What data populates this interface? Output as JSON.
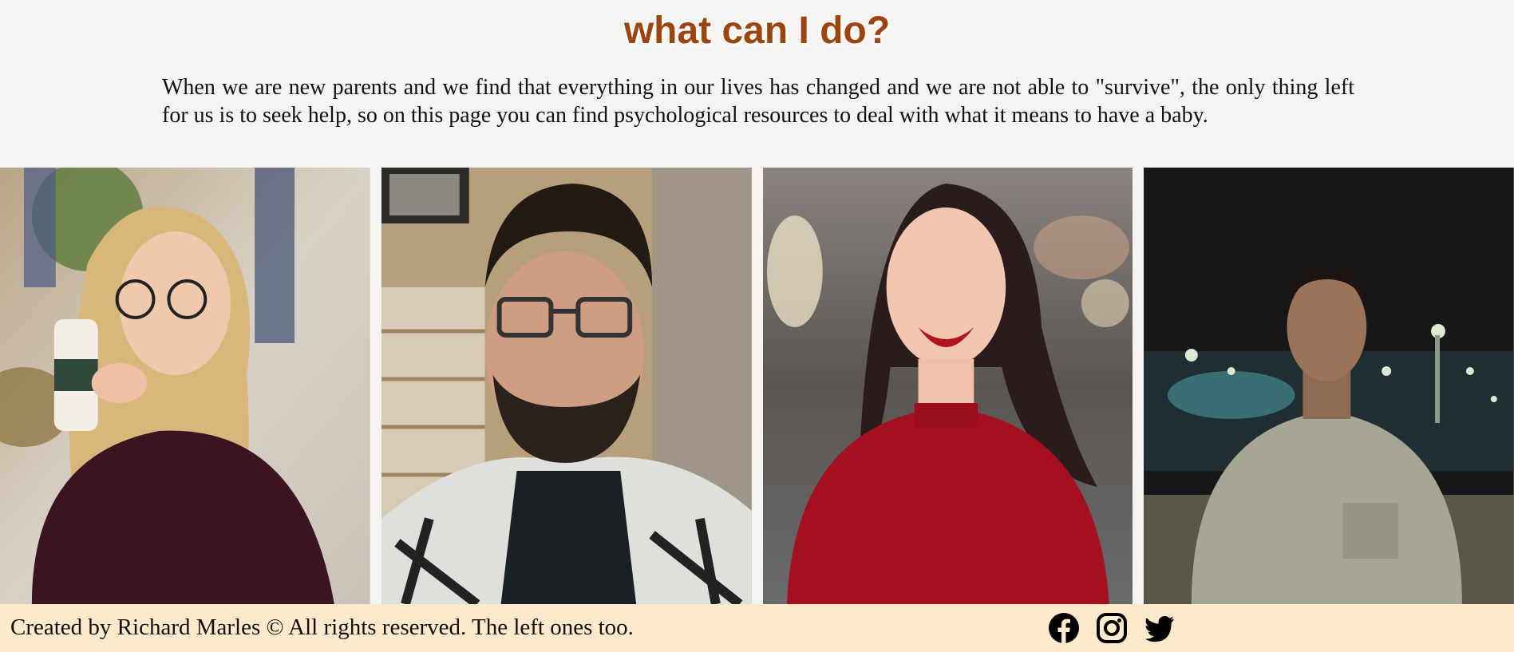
{
  "header": {
    "title": "what can I do?",
    "intro": "When we are new parents and we find that everything in our lives has changed and we are not able to \"survive\", the only thing left for us is to seek help, so on this page you can find psychological resources to deal with what it means to have a baby."
  },
  "gallery": {
    "photos": [
      {
        "subject": "woman with glasses drinking coffee"
      },
      {
        "subject": "man with glasses and beard in plaid shirt"
      },
      {
        "subject": "smiling woman in red top"
      },
      {
        "subject": "young man in grey t-shirt at night"
      }
    ]
  },
  "footer": {
    "credits": "Created by Richard Marles © All rights reserved. The left ones too.",
    "social": [
      {
        "icon": "facebook-icon"
      },
      {
        "icon": "instagram-icon"
      },
      {
        "icon": "twitter-icon"
      }
    ]
  },
  "colors": {
    "background": "#f5f4f2",
    "title": "#9c4511",
    "footer_background": "#fde9cc"
  }
}
